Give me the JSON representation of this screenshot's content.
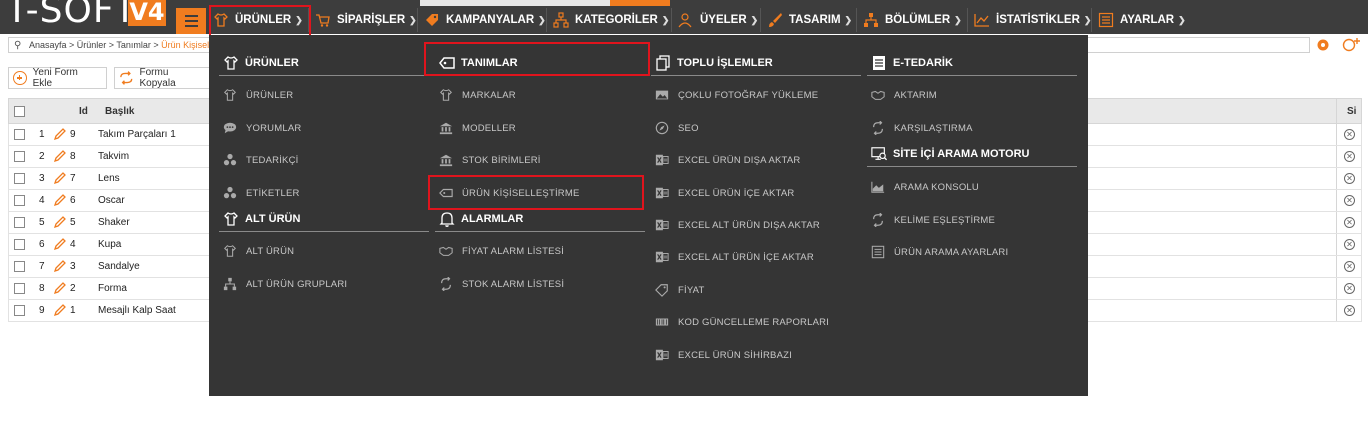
{
  "app": {
    "logo_text": "T-SOFT",
    "logo_version": "V4"
  },
  "nav": [
    {
      "label": "ÜRÜNLER",
      "icon": "shirt-icon"
    },
    {
      "label": "SİPARİŞLER",
      "icon": "cart-icon"
    },
    {
      "label": "KAMPANYALAR",
      "icon": "tag-icon"
    },
    {
      "label": "KATEGORİLER",
      "icon": "sitemap-icon"
    },
    {
      "label": "ÜYELER",
      "icon": "users-icon"
    },
    {
      "label": "TASARIM",
      "icon": "brush-icon"
    },
    {
      "label": "BÖLÜMLER",
      "icon": "blocks-icon"
    },
    {
      "label": "İSTATİSTİKLER",
      "icon": "chart-icon"
    },
    {
      "label": "AYARLAR",
      "icon": "list-icon"
    }
  ],
  "breadcrumb": {
    "path": "Anasayfa > Ürünler > Tanımlar > ",
    "current": "Ürün Kişisel"
  },
  "toolbar": {
    "new_form": "Yeni Form Ekle",
    "copy_form": "Formu Kopyala"
  },
  "table": {
    "headers": {
      "id": "Id",
      "title": "Başlık",
      "del": "Si"
    },
    "rows": [
      {
        "n": "1",
        "id": "9",
        "title": "Takım Parçaları 1"
      },
      {
        "n": "2",
        "id": "8",
        "title": "Takvim"
      },
      {
        "n": "3",
        "id": "7",
        "title": "Lens"
      },
      {
        "n": "4",
        "id": "6",
        "title": "Oscar"
      },
      {
        "n": "5",
        "id": "5",
        "title": "Shaker"
      },
      {
        "n": "6",
        "id": "4",
        "title": "Kupa"
      },
      {
        "n": "7",
        "id": "3",
        "title": "Sandalye"
      },
      {
        "n": "8",
        "id": "2",
        "title": "Forma"
      },
      {
        "n": "9",
        "id": "1",
        "title": "Mesajlı Kalp Saat"
      }
    ]
  },
  "menu": {
    "urunler": {
      "title": "ÜRÜNLER",
      "items": [
        "ÜRÜNLER",
        "YORUMLAR",
        "TEDARİKÇİ",
        "ETİKETLER"
      ]
    },
    "alt_urun": {
      "title": "ALT ÜRÜN",
      "items": [
        "ALT ÜRÜN",
        "ALT ÜRÜN GRUPLARI"
      ]
    },
    "tanimlar": {
      "title": "TANIMLAR",
      "items": [
        "MARKALAR",
        "MODELLER",
        "STOK BİRİMLERİ",
        "ÜRÜN KİŞİSELLEŞTİRME"
      ]
    },
    "alarmlar": {
      "title": "ALARMLAR",
      "items": [
        "FİYAT ALARM LİSTESİ",
        "STOK ALARM LİSTESİ"
      ]
    },
    "toplu": {
      "title": "TOPLU İŞLEMLER",
      "items": [
        "ÇOKLU FOTOĞRAF YÜKLEME",
        "SEO",
        "EXCEL ÜRÜN DIŞA AKTAR",
        "EXCEL ÜRÜN İÇE AKTAR",
        "EXCEL ALT ÜRÜN DIŞA AKTAR",
        "EXCEL ALT ÜRÜN İÇE AKTAR",
        "FİYAT",
        "KOD GÜNCELLEME RAPORLARI",
        "EXCEL ÜRÜN SİHİRBAZI"
      ]
    },
    "etedarik": {
      "title": "E-TEDARİK",
      "items": [
        "AKTARIM",
        "KARŞILAŞTIRMA"
      ]
    },
    "arama": {
      "title": "SİTE İÇİ ARAMA MOTORU",
      "items": [
        "ARAMA KONSOLU",
        "KELİME EŞLEŞTİRME",
        "ÜRÜN ARAMA AYARLARI"
      ]
    }
  },
  "colors": {
    "accent": "#f07c1f",
    "menu_bg": "#353535",
    "nav_bg": "#3d3d3d",
    "highlight": "#e0141d"
  }
}
